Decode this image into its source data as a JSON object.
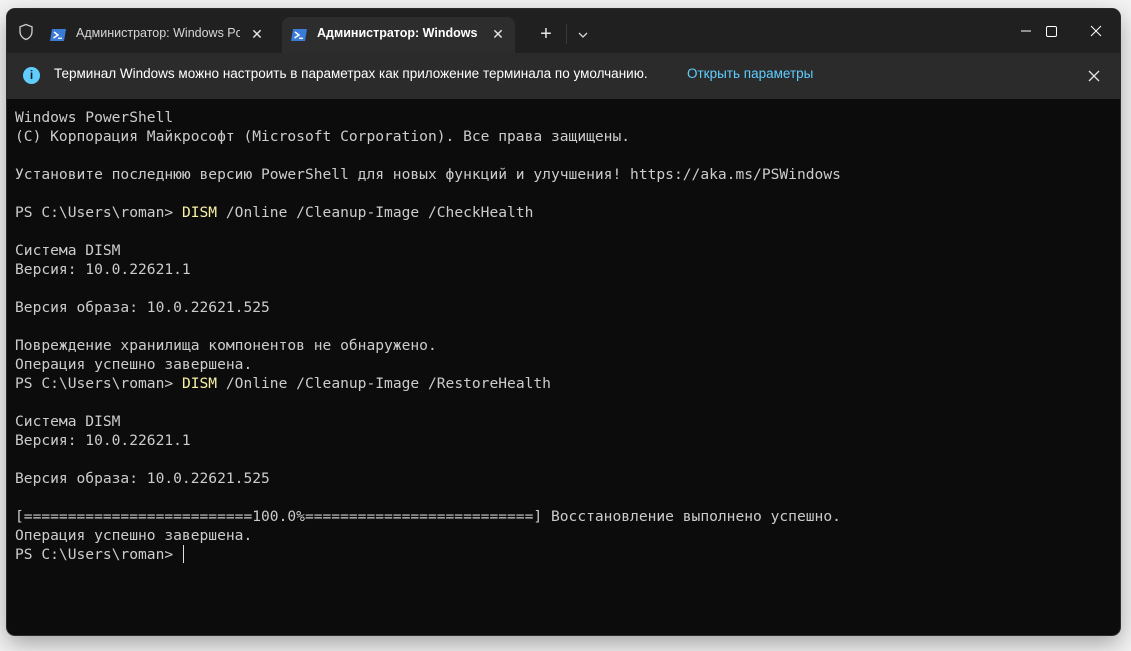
{
  "tabs": [
    {
      "label": "Администратор: Windows PowerShell",
      "icon": "powershell-icon",
      "active": false
    },
    {
      "label": "Администратор: Windows PowerShell",
      "icon": "powershell-icon",
      "active": true
    }
  ],
  "infobar": {
    "message": "Терминал Windows можно настроить в параметрах как приложение терминала по умолчанию.",
    "link": "Открыть параметры"
  },
  "terminal": {
    "lines": [
      {
        "text": "Windows PowerShell"
      },
      {
        "text": "(C) Корпорация Майкрософт (Microsoft Corporation). Все права защищены."
      },
      {
        "text": ""
      },
      {
        "text": "Установите последнюю версию PowerShell для новых функций и улучшения! https://aka.ms/PSWindows"
      },
      {
        "text": ""
      },
      {
        "prompt": "PS C:\\Users\\roman> ",
        "command": "DISM",
        "args": " /Online /Cleanup-Image /CheckHealth"
      },
      {
        "text": ""
      },
      {
        "text": "Система DISM"
      },
      {
        "text": "Версия: 10.0.22621.1"
      },
      {
        "text": ""
      },
      {
        "text": "Версия образа: 10.0.22621.525"
      },
      {
        "text": ""
      },
      {
        "text": "Повреждение хранилища компонентов не обнаружено."
      },
      {
        "text": "Операция успешно завершена."
      },
      {
        "prompt": "PS C:\\Users\\roman> ",
        "command": "DISM",
        "args": " /Online /Cleanup-Image /RestoreHealth"
      },
      {
        "text": ""
      },
      {
        "text": "Система DISM"
      },
      {
        "text": "Версия: 10.0.22621.1"
      },
      {
        "text": ""
      },
      {
        "text": "Версия образа: 10.0.22621.525"
      },
      {
        "text": ""
      },
      {
        "text": "[==========================100.0%==========================] Восстановление выполнено успешно."
      },
      {
        "text": "Операция успешно завершена."
      },
      {
        "prompt": "PS C:\\Users\\roman> ",
        "command": "",
        "args": "",
        "cursor": true
      }
    ]
  },
  "colors": {
    "terminal_bg": "#0c0c0c",
    "terminal_fg": "#cccccc",
    "command": "#f9f1a5",
    "link": "#60cdff",
    "titlebar": "#202020",
    "active_tab": "#2d2d2d",
    "infobar": "#2b2b2b"
  }
}
